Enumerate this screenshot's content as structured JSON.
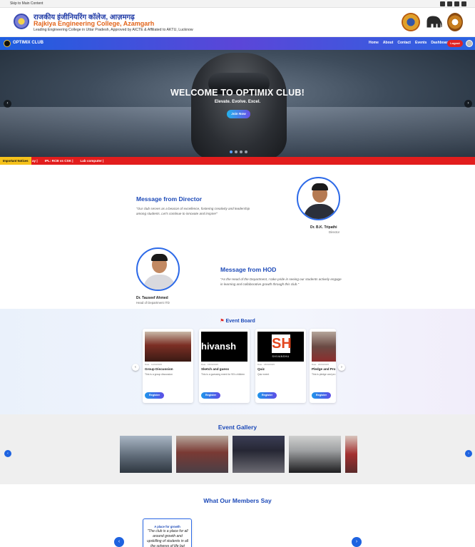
{
  "topbar": {
    "skip_link": "Skip to Main Content"
  },
  "header": {
    "hindi_name": "राजकीय इंजीनियरिंग कॉलेज, आज़मगढ़",
    "college_name": "Rajkiya Engineering College, Azamgarh",
    "tagline": "Leading Engineering College in Uttar Pradesh, Approved by AICTE & Affiliated to AKTU, Lucknow"
  },
  "navbar": {
    "brand": "OPTIMIX CLUB",
    "links": [
      "Home",
      "About",
      "Contact",
      "Events",
      "Dashboard"
    ],
    "logout": "Logout"
  },
  "hero": {
    "title": "WELCOME TO OPTIMIX CLUB!",
    "subtitle": "Elevate. Evolve. Excel.",
    "cta": "Join Now",
    "prev": "‹",
    "next": "›"
  },
  "ticker": {
    "label": "Important Notices",
    "items": [
      "ay |",
      "IPL: RCB vs CSK |",
      "Lab computer |"
    ]
  },
  "director": {
    "heading": "Message from Director",
    "quote": "\"Our club serves as a beacon of excellence, fostering creativity and leadership among students. Let's continue to innovate and inspire!\"",
    "name": "Dr. B.K. Tripathi",
    "role": "Director"
  },
  "hod": {
    "heading": "Message from HOD",
    "quote": "\"As the Head of the Department, I take pride in seeing our students actively engage in learning and collaborative growth through this club.\"",
    "name": "Dr. Tauseef Ahmed",
    "role": "Head of Department ITD"
  },
  "event_board": {
    "title": "Event Board",
    "prev": "‹",
    "next": "›",
    "cards": [
      {
        "meta": "Date · 12/03/2025",
        "title": "Group Discussion",
        "desc": "This is a group discussion",
        "button": "Register"
      },
      {
        "meta": "Date · 15/03/2025",
        "title": "Sketch and guess",
        "desc": "This is a guessing event for 90's children",
        "button": "Register"
      },
      {
        "meta": "Date · 18/03/2025",
        "title": "Quiz",
        "desc": "Quiz event",
        "button": "Register"
      },
      {
        "meta": "Date · 20/03/2025",
        "title": "Pledge and Pro",
        "desc": "This is pledge and pro",
        "button": "Register"
      }
    ],
    "card_image_text": [
      "hivansh",
      "SHIVANSHU"
    ]
  },
  "gallery": {
    "title": "Event Gallery",
    "prev": "‹",
    "next": "›"
  },
  "testimonials": {
    "title": "What Our Members Say",
    "card_heading": "A place for growth",
    "card_quote": "\"The club is a place for all around growth and upskilling of students in all the spheres of life but",
    "prev": "‹",
    "next": "›"
  },
  "colors": {
    "accent_blue": "#1d4ab8",
    "nav_gradient_start": "#1e5fe0",
    "logout_red": "#e02424",
    "ticker_red": "#e21d1d",
    "ticker_label": "#f6c21b"
  }
}
